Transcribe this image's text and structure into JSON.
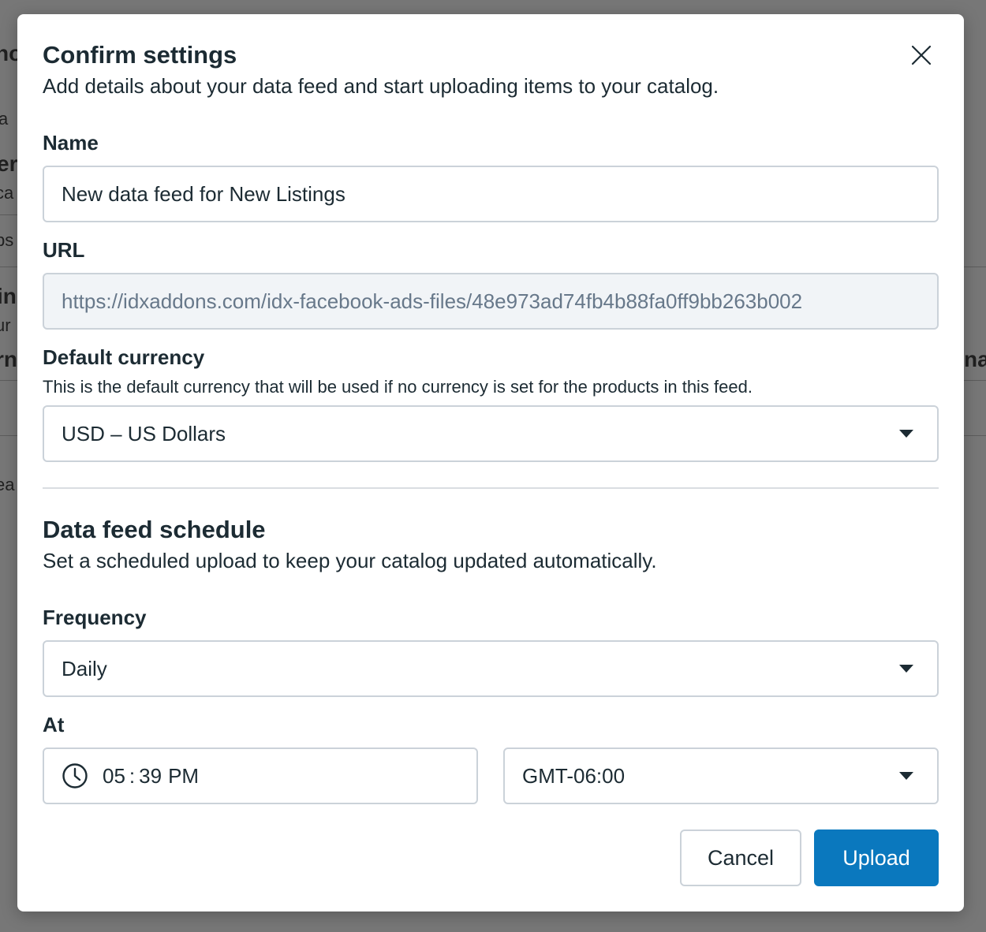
{
  "background": {
    "fragments": [
      "no",
      "a",
      "er",
      "ca",
      "ps",
      "in",
      "ur",
      "rn",
      "na",
      "ea"
    ]
  },
  "modal": {
    "title": "Confirm settings",
    "subtitle": "Add details about your data feed and start uploading items to your catalog.",
    "name": {
      "label": "Name",
      "value": "New data feed for New Listings"
    },
    "url": {
      "label": "URL",
      "value": "https://idxaddons.com/idx-facebook-ads-files/48e973ad74fb4b88fa0ff9bb263b002"
    },
    "currency": {
      "label": "Default currency",
      "helper": "This is the default currency that will be used if no currency is set for the products in this feed.",
      "value": "USD – US Dollars"
    },
    "schedule": {
      "title": "Data feed schedule",
      "subtitle": "Set a scheduled upload to keep your catalog updated automatically.",
      "frequency_label": "Frequency",
      "frequency_value": "Daily",
      "at_label": "At",
      "time_hour": "05",
      "time_minute": "39",
      "time_period": "PM",
      "timezone": "GMT-06:00"
    },
    "buttons": {
      "cancel": "Cancel",
      "upload": "Upload"
    }
  },
  "colors": {
    "primary": "#0a78be",
    "text": "#1c2b33",
    "border": "#cbd2d9",
    "disabled_bg": "#f1f4f7"
  }
}
